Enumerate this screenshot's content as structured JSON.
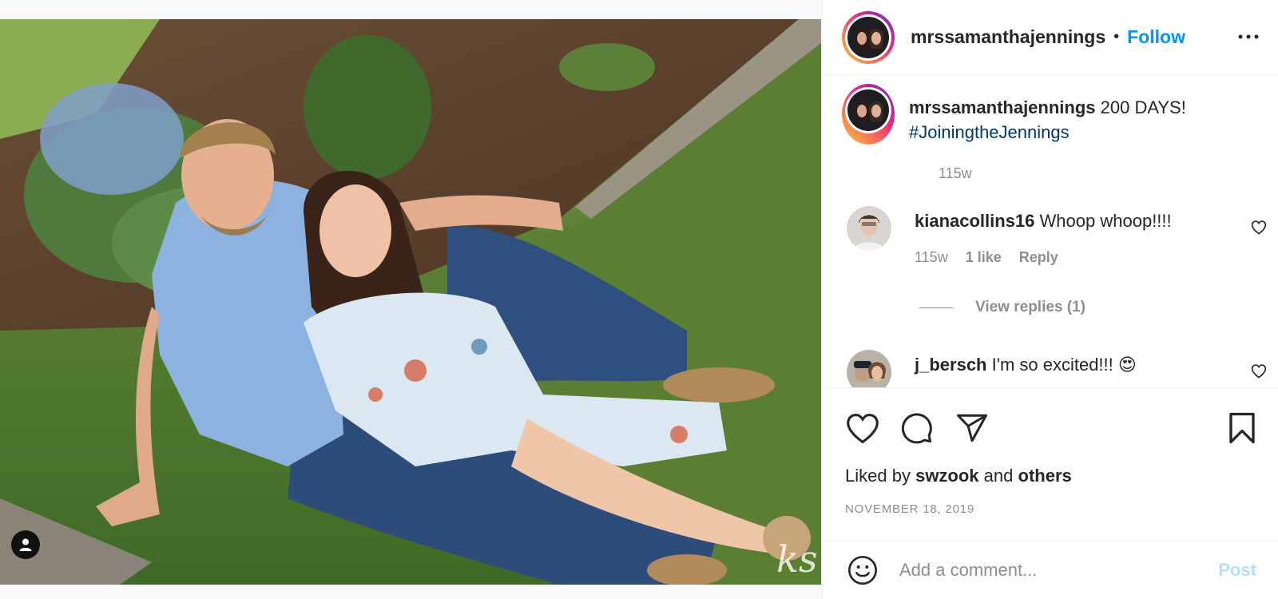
{
  "post": {
    "author": "mrssamanthajennings",
    "separator": "•",
    "follow_label": "Follow",
    "more_icon": "more-options-icon"
  },
  "caption": {
    "username": "mrssamanthajennings",
    "text": "200 DAYS!",
    "hashtag": "#JoiningtheJennings",
    "time": "115w"
  },
  "comments": [
    {
      "username": "kianacollins16",
      "text": "Whoop whoop!!!!",
      "time": "115w",
      "likes": "1 like",
      "reply_label": "Reply",
      "view_replies": "View replies (1)"
    },
    {
      "username": "j_bersch",
      "text": "I'm so excited!!! 😍"
    }
  ],
  "likes": {
    "prefix": "Liked by",
    "user": "swzook",
    "and": "and",
    "others": "others"
  },
  "date": "NOVEMBER 18, 2019",
  "add_comment": {
    "placeholder": "Add a comment...",
    "post_label": "Post"
  },
  "photo": {
    "watermark": "ks"
  },
  "colors": {
    "accent": "#0095f6",
    "hashtag": "#00376b",
    "muted": "#8e8e8e",
    "post_disabled": "#b2dffc"
  }
}
